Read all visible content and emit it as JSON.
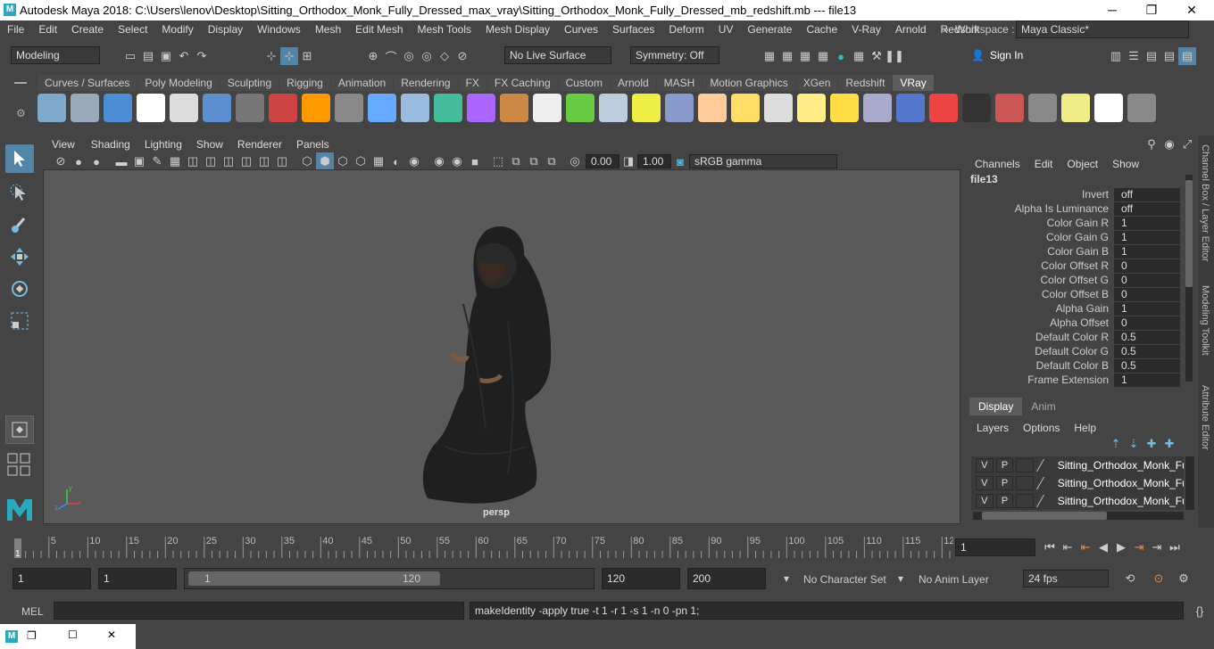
{
  "window": {
    "title": "Autodesk Maya 2018: C:\\Users\\lenov\\Desktop\\Sitting_Orthodox_Monk_Fully_Dressed_max_vray\\Sitting_Orthodox_Monk_Fully_Dressed_mb_redshift.mb   ---   file13",
    "minimize": "─",
    "maximize": "❐",
    "close": "✕"
  },
  "menubar": {
    "items": [
      "File",
      "Edit",
      "Create",
      "Select",
      "Modify",
      "Display",
      "Windows",
      "Mesh",
      "Edit Mesh",
      "Mesh Tools",
      "Mesh Display",
      "Curves",
      "Surfaces",
      "Deform",
      "UV",
      "Generate",
      "Cache",
      "V-Ray",
      "Arnold",
      "Redshift"
    ],
    "overflow": "»",
    "workspace_label": "Workspace :",
    "workspace_value": "Maya Classic*"
  },
  "toolbar": {
    "mode": "Modeling",
    "live_surface": "No Live Surface",
    "symmetry": "Symmetry: Off",
    "sign_in": "Sign In"
  },
  "shelf": {
    "tabs": [
      "Curves / Surfaces",
      "Poly Modeling",
      "Sculpting",
      "Rigging",
      "Animation",
      "Rendering",
      "FX",
      "FX Caching",
      "Custom",
      "Arnold",
      "MASH",
      "Motion Graphics",
      "XGen",
      "Redshift",
      "VRay"
    ],
    "active_tab": "VRay",
    "icon_colors": [
      "#7fa7c9",
      "#9ab",
      "#4a8fd6",
      "#ffffff",
      "#dddddd",
      "#5b8fcf",
      "#777",
      "#c44",
      "#f90",
      "#888",
      "#6af",
      "#9bd",
      "#4b9",
      "#a6f",
      "#c84",
      "#eee",
      "#6c4",
      "#bcd",
      "#ee4",
      "#89c",
      "#fc9",
      "#fd6",
      "#ddd",
      "#fe8",
      "#fd4",
      "#aac",
      "#57c",
      "#e44",
      "#333",
      "#c55",
      "#888",
      "#ee8",
      "#fff",
      "#888"
    ]
  },
  "viewport": {
    "menu": [
      "View",
      "Shading",
      "Lighting",
      "Show",
      "Renderer",
      "Panels"
    ],
    "exposure": "0.00",
    "gamma": "1.00",
    "color_space": "sRGB gamma",
    "camera_label": "persp",
    "axis_x": "x",
    "axis_y": "y",
    "axis_z": "z"
  },
  "channel_box": {
    "menu": [
      "Channels",
      "Edit",
      "Object",
      "Show"
    ],
    "node": "file13",
    "side_tabs": [
      "Channel Box / Layer Editor",
      "Modeling Toolkit",
      "Attribute Editor"
    ],
    "attributes": [
      {
        "name": "Invert",
        "value": "off"
      },
      {
        "name": "Alpha Is Luminance",
        "value": "off"
      },
      {
        "name": "Color Gain R",
        "value": "1"
      },
      {
        "name": "Color Gain G",
        "value": "1"
      },
      {
        "name": "Color Gain B",
        "value": "1"
      },
      {
        "name": "Color Offset R",
        "value": "0"
      },
      {
        "name": "Color Offset G",
        "value": "0"
      },
      {
        "name": "Color Offset B",
        "value": "0"
      },
      {
        "name": "Alpha Gain",
        "value": "1"
      },
      {
        "name": "Alpha Offset",
        "value": "0"
      },
      {
        "name": "Default Color R",
        "value": "0.5"
      },
      {
        "name": "Default Color G",
        "value": "0.5"
      },
      {
        "name": "Default Color B",
        "value": "0.5"
      },
      {
        "name": "Frame Extension",
        "value": "1"
      }
    ]
  },
  "layer_editor": {
    "tabs": [
      "Display",
      "Anim"
    ],
    "menu": [
      "Layers",
      "Options",
      "Help"
    ],
    "layers": [
      {
        "v": "V",
        "p": "P",
        "name": "Sitting_Orthodox_Monk_Fu"
      },
      {
        "v": "V",
        "p": "P",
        "name": "Sitting_Orthodox_Monk_Fu"
      },
      {
        "v": "V",
        "p": "P",
        "name": "Sitting_Orthodox_Monk_Fu"
      }
    ]
  },
  "timeline": {
    "ticks": [
      "5",
      "10",
      "15",
      "20",
      "25",
      "30",
      "35",
      "40",
      "45",
      "50",
      "55",
      "60",
      "65",
      "70",
      "75",
      "80",
      "85",
      "90",
      "95",
      "100",
      "105",
      "110",
      "115",
      "12"
    ],
    "start_marker": "1",
    "current_frame": "1"
  },
  "range": {
    "start": "1",
    "playback_start": "1",
    "slider_start": "1",
    "slider_end": "120",
    "playback_end": "120",
    "end": "200",
    "character_set": "No Character Set",
    "anim_layer": "No Anim Layer",
    "fps": "24 fps"
  },
  "command": {
    "language": "MEL",
    "result": "makeIdentity -apply true -t 1 -r 1 -s 1 -n 0 -pn 1;"
  },
  "taskbar": {
    "restore": "❐",
    "maximize": "☐",
    "close": "✕"
  }
}
